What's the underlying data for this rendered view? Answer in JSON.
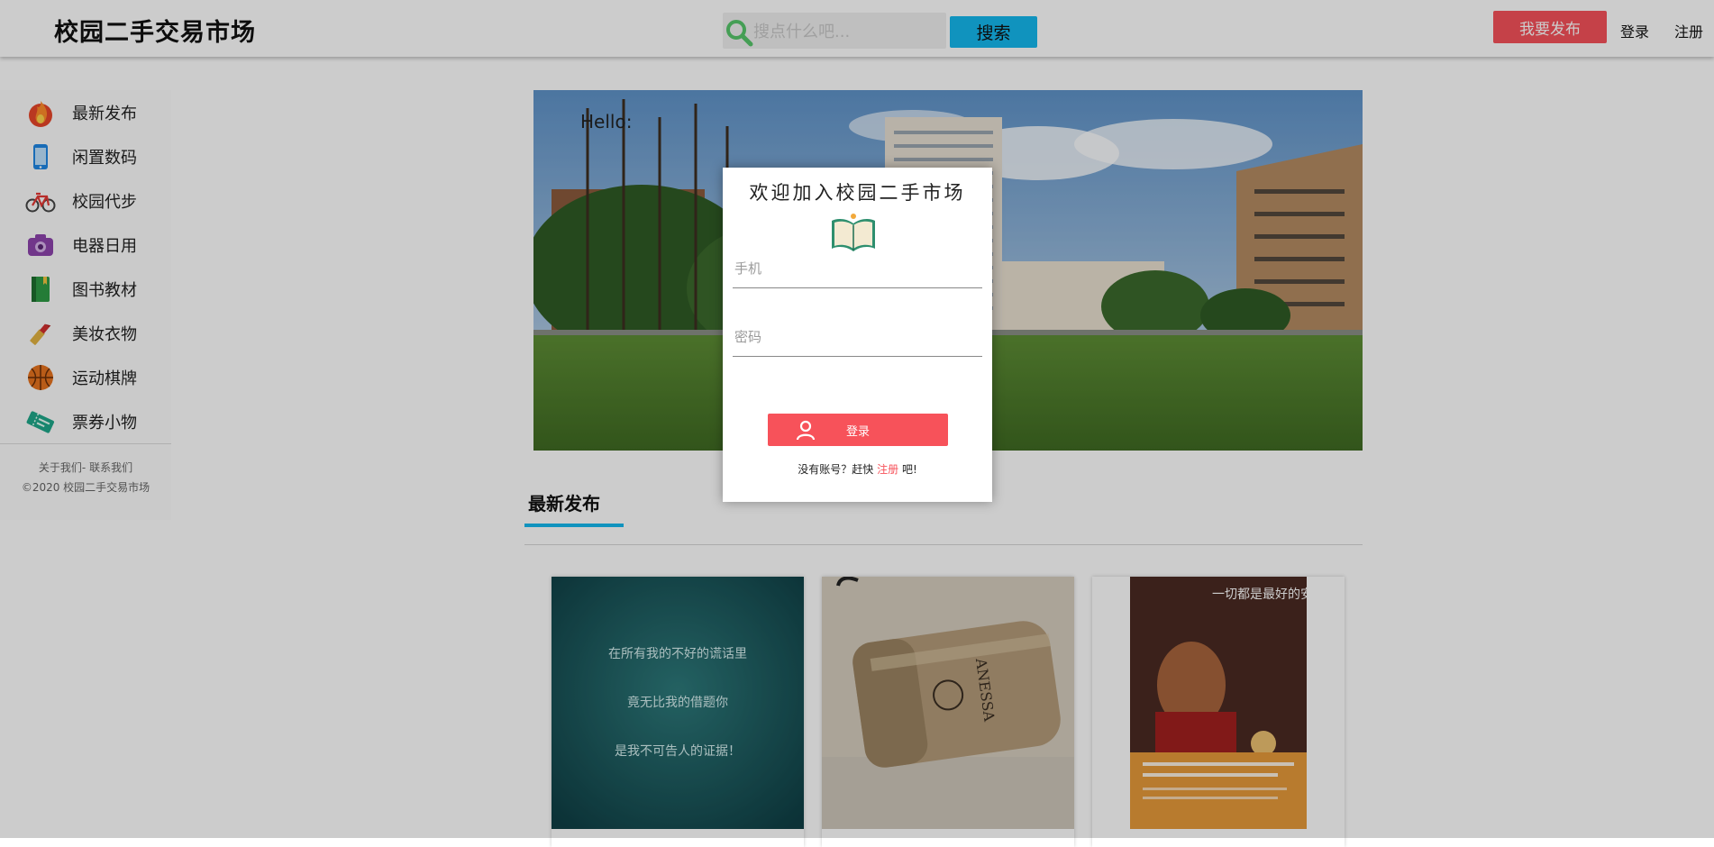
{
  "header": {
    "title": "校园二手交易市场",
    "search": {
      "placeholder": "搜点什么吧...",
      "value": ""
    },
    "search_button": "搜索",
    "publish_button": "我要发布",
    "login_link": "登录",
    "register_link": "注册"
  },
  "sidebar": {
    "items": [
      {
        "label": "最新发布",
        "icon": "flame-icon"
      },
      {
        "label": "闲置数码",
        "icon": "phone-icon"
      },
      {
        "label": "校园代步",
        "icon": "bicycle-icon"
      },
      {
        "label": "电器日用",
        "icon": "camera-icon"
      },
      {
        "label": "图书教材",
        "icon": "book-icon"
      },
      {
        "label": "美妆衣物",
        "icon": "lipstick-icon"
      },
      {
        "label": "运动棋牌",
        "icon": "basketball-icon"
      },
      {
        "label": "票券小物",
        "icon": "ticket-icon"
      }
    ],
    "footer_links": "关于我们- 联系我们",
    "footer_copyright": "©2020 校园二手交易市场"
  },
  "banner": {
    "greeting": "Hello:"
  },
  "latest": {
    "title": "最新发布",
    "products": [
      {
        "image": "chalkboard-quote-image",
        "lines": [
          "在所有我的不好的谎话里",
          "竟无比我的借题你",
          "是我不可告人的证据！"
        ]
      },
      {
        "image": "sunscreen-bottle-image",
        "text": "ANESSA"
      },
      {
        "image": "book-cover-image",
        "text": "一切都是最好的安排"
      }
    ]
  },
  "login_modal": {
    "title": "欢迎加入校园二手市场",
    "phone_placeholder": "手机",
    "password_placeholder": "密码",
    "login_button": "登录",
    "hint_prefix": "没有账号？赶快",
    "hint_link": "注册",
    "hint_suffix": "吧!"
  },
  "colors": {
    "accent_blue": "#14b8ee",
    "accent_red": "#f7525a",
    "overlay": "rgba(0,0,0,0.2)"
  }
}
